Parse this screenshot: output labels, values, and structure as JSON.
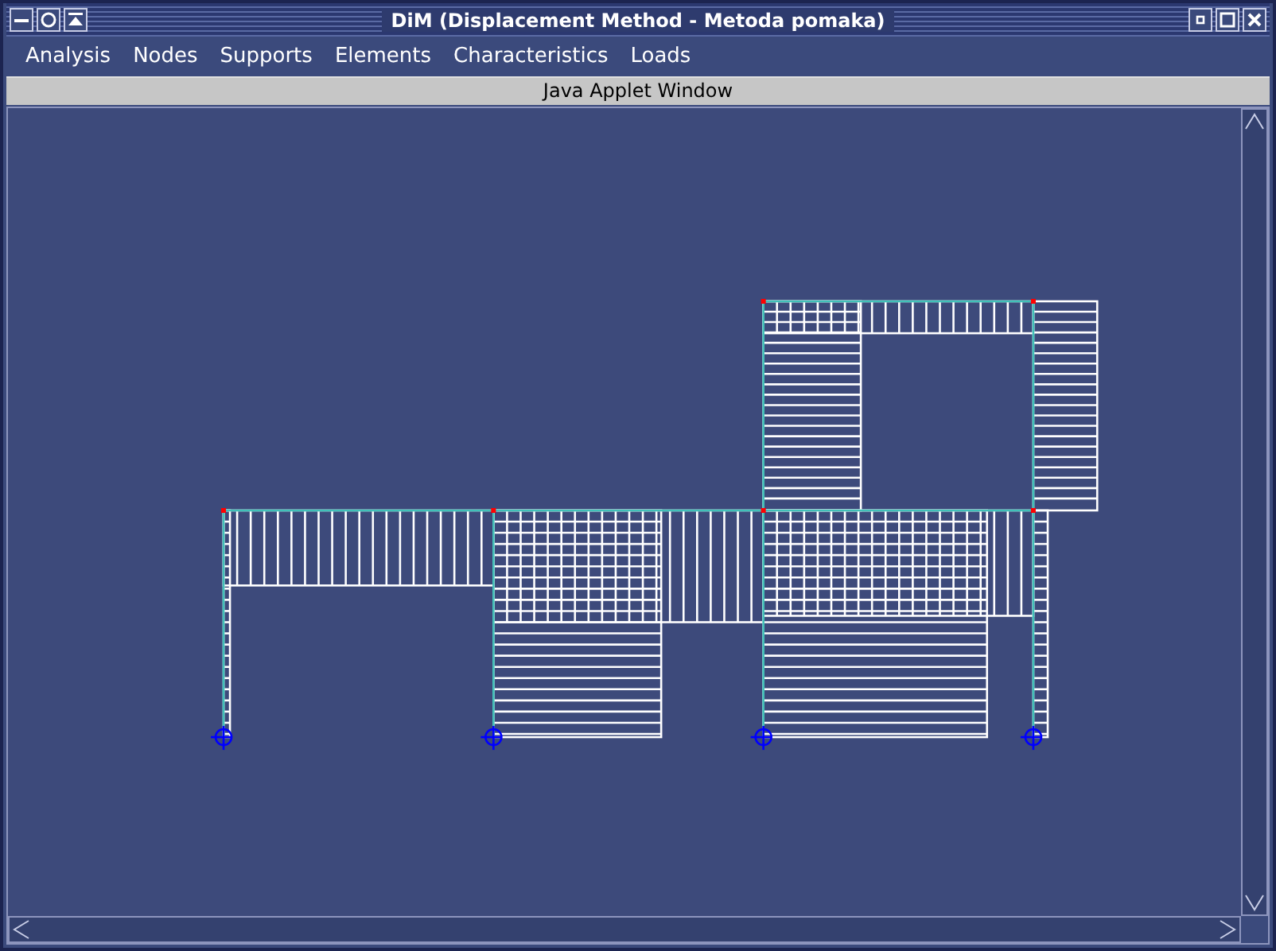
{
  "window": {
    "title": "DiM (Displacement Method - Metoda pomaka)"
  },
  "menu": [
    "Analysis",
    "Nodes",
    "Supports",
    "Elements",
    "Characteristics",
    "Loads"
  ],
  "applet_banner": "Java Applet Window"
}
